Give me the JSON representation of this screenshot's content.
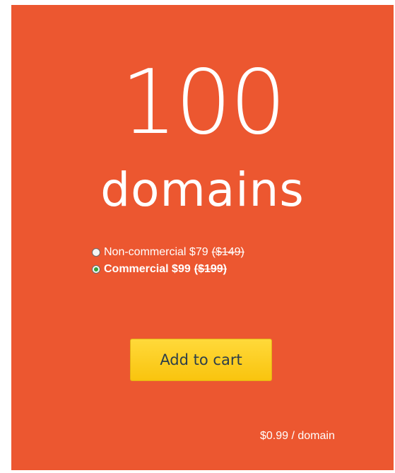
{
  "offer": {
    "quantity": "100",
    "unit": "domains"
  },
  "license_options": [
    {
      "label": "Non-commercial $79",
      "old_price": "($149)",
      "selected": false
    },
    {
      "label": "Commercial $99",
      "old_price": "($199)",
      "selected": true
    }
  ],
  "cart": {
    "button_label": "Add to cart"
  },
  "price_per_domain": "$0.99 / domain",
  "colors": {
    "card_background": "#ec5730",
    "button_yellow": "#f9c40e",
    "radio_selected": "#2fa43c"
  }
}
